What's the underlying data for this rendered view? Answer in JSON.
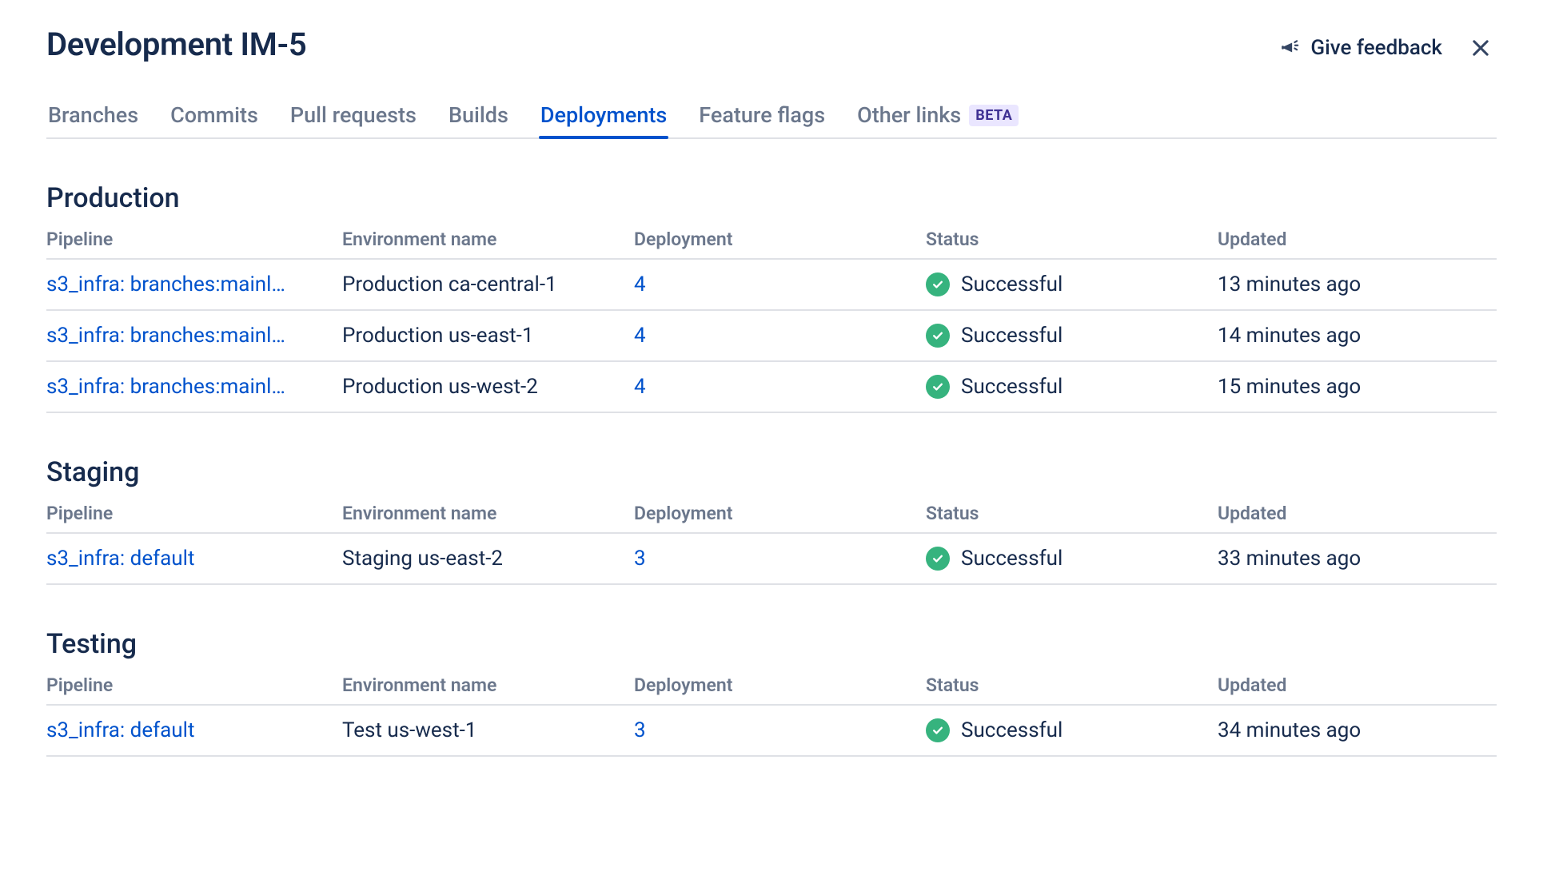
{
  "header": {
    "title": "Development IM-5",
    "feedback_label": "Give feedback"
  },
  "tabs": [
    {
      "label": "Branches",
      "active": false
    },
    {
      "label": "Commits",
      "active": false
    },
    {
      "label": "Pull requests",
      "active": false
    },
    {
      "label": "Builds",
      "active": false
    },
    {
      "label": "Deployments",
      "active": true
    },
    {
      "label": "Feature flags",
      "active": false
    },
    {
      "label": "Other links",
      "active": false,
      "badge": "BETA"
    }
  ],
  "columns": {
    "pipeline": "Pipeline",
    "environment": "Environment name",
    "deployment": "Deployment",
    "status": "Status",
    "updated": "Updated"
  },
  "sections": [
    {
      "title": "Production",
      "rows": [
        {
          "pipeline": "s3_infra: branches:mainl…",
          "environment": "Production ca-central-1",
          "deployment": "4",
          "status": "Successful",
          "updated": "13 minutes ago"
        },
        {
          "pipeline": "s3_infra: branches:mainl…",
          "environment": "Production us-east-1",
          "deployment": "4",
          "status": "Successful",
          "updated": "14 minutes ago"
        },
        {
          "pipeline": "s3_infra: branches:mainl…",
          "environment": "Production us-west-2",
          "deployment": "4",
          "status": "Successful",
          "updated": "15 minutes ago"
        }
      ]
    },
    {
      "title": "Staging",
      "rows": [
        {
          "pipeline": "s3_infra: default",
          "environment": "Staging us-east-2",
          "deployment": "3",
          "status": "Successful",
          "updated": "33 minutes ago"
        }
      ]
    },
    {
      "title": "Testing",
      "rows": [
        {
          "pipeline": "s3_infra: default",
          "environment": "Test us-west-1",
          "deployment": "3",
          "status": "Successful",
          "updated": "34 minutes ago"
        }
      ]
    }
  ]
}
